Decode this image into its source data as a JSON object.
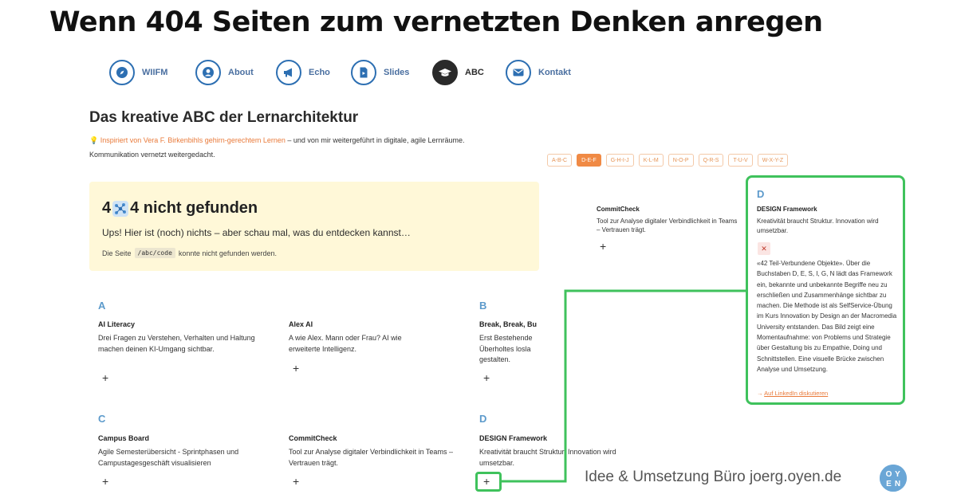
{
  "headline": "Wenn 404 Seiten zum vernetzten Denken anregen",
  "nav": [
    {
      "label": "WIIFM",
      "icon": "compass-icon"
    },
    {
      "label": "About",
      "icon": "user-icon"
    },
    {
      "label": "Echo",
      "icon": "megaphone-icon"
    },
    {
      "label": "Slides",
      "icon": "slides-file-icon"
    },
    {
      "label": "ABC",
      "icon": "graduation-cap-icon",
      "active": true
    },
    {
      "label": "Kontakt",
      "icon": "envelope-icon"
    }
  ],
  "section_title": "Das kreative ABC der Lernarchitektur",
  "intro": {
    "bulb": "💡",
    "link": "Inspiriert von Vera F. Birkenbihls gehirn-gerechtem Lernen",
    "rest": " – und von mir weitergeführt in digitale, agile Lernräume.",
    "line2": "Kommunikation vernetzt weitergedacht."
  },
  "abc_tabs": [
    "A-B-C",
    "D-E-F",
    "G-H-I-J",
    "K-L-M",
    "N-O-P",
    "Q-R-S",
    "T-U-V",
    "W-X-Y-Z"
  ],
  "abc_active": "D-E-F",
  "error": {
    "title_a": "4",
    "title_b": "4 nicht gefunden",
    "subtitle": "Ups! Hier ist (noch) nichts – aber schau mal, was du entdecken kannst…",
    "path_prefix": "Die Seite",
    "path": "/abc/code",
    "path_suffix": "konnte nicht gefunden werden."
  },
  "cards": [
    {
      "letter": "A",
      "title": "AI Literacy",
      "desc": "Drei Fragen zu Verstehen, Verhalten und Haltung machen deinen KI-Umgang sichtbar."
    },
    {
      "letter": "",
      "title": "Alex AI",
      "desc": "A wie Alex. Mann oder Frau? AI wie erweiterte Intelligenz."
    },
    {
      "letter": "B",
      "title": "Break, Break, Bu",
      "desc": "Erst Bestehende Überholtes losla gestalten."
    },
    {
      "letter": "C",
      "title": "Campus Board",
      "desc": "Agile Semesterübersicht - Sprintphasen und Campustagesgeschäft visualisieren"
    },
    {
      "letter": "",
      "title": "CommitCheck",
      "desc": "Tool zur Analyse digitaler Verbindlichkeit in Teams – Vertrauen trägt."
    },
    {
      "letter": "D",
      "title": "DESIGN Framework",
      "desc": "Kreativität braucht Struktur. Innovation wird umsetzbar."
    }
  ],
  "top_card": {
    "title": "CommitCheck",
    "desc": "Tool zur Analyse digitaler Verbindlichkeit in Teams – Vertrauen trägt."
  },
  "plus": "+",
  "popup": {
    "letter": "D",
    "title": "DESIGN Framework",
    "desc": "Kreativität braucht Struktur. Innovation wird umsetzbar.",
    "close": "✕",
    "long": "«42 Teil-Verbundene Objekte». Über die Buchstaben D, E, S, I, G, N lädt das Framework ein, bekannte und unbekannte Begriffe neu zu erschließen und Zusammenhänge sichtbar zu machen. Die Methode ist als SelfService-Übung im Kurs Innovation by Design an der Macromedia University entstanden. Das Bild zeigt eine Momentaufnahme: von Problems und Strategie über Gestaltung bis zu Empathie, Doing und Schnittstellen. Eine visuelle Brücke zwischen Analyse und Umsetzung.",
    "link_arrow": "→ ",
    "link": "Auf LinkedIn diskutieren"
  },
  "credit": "Idee & Umsetzung Büro joerg.oyen.de",
  "brand_logo": "OYEN",
  "colors": {
    "accent_orange": "#f08a45",
    "link_blue": "#2d6fb2",
    "highlight_green": "#3fc25c",
    "error_bg": "#fff8d8",
    "letter_blue": "#5c9acb"
  }
}
